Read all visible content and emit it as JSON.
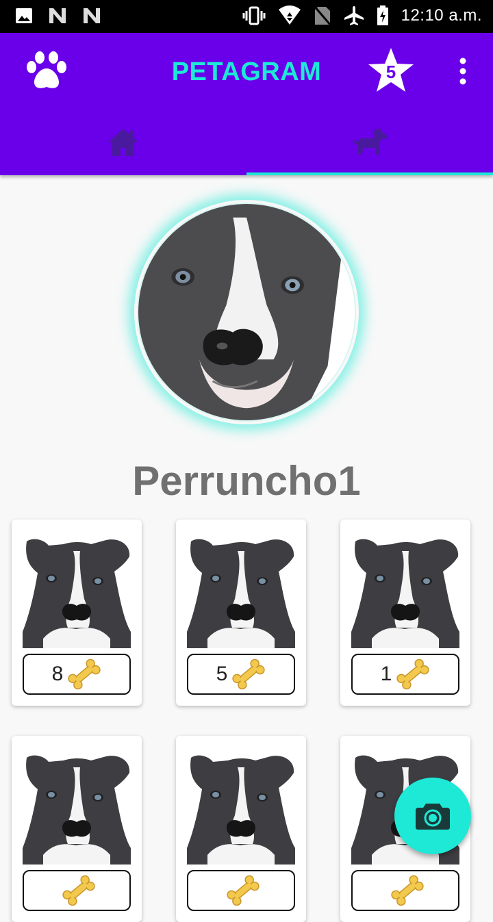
{
  "status_bar": {
    "time": "12:10 a.m.",
    "left_icons": [
      "image-icon",
      "n-icon",
      "n-icon"
    ],
    "right_icons": [
      "vibrate-icon",
      "wifi-icon",
      "no-sim-icon",
      "airplane-icon",
      "battery-charging-icon"
    ]
  },
  "app_bar": {
    "title": "PETAGRAM",
    "favorites_count": "5",
    "left_icon": "paw-icon",
    "menu_icon": "more-vert-icon"
  },
  "tabs": [
    {
      "icon": "home-icon",
      "selected": false
    },
    {
      "icon": "dog-icon",
      "selected": true
    }
  ],
  "profile": {
    "username": "Perruncho1"
  },
  "photos": [
    {
      "likes": "8"
    },
    {
      "likes": "5"
    },
    {
      "likes": "1"
    },
    {
      "likes": ""
    },
    {
      "likes": ""
    },
    {
      "likes": ""
    }
  ],
  "fab": {
    "icon": "camera-icon"
  },
  "colors": {
    "primary": "#6a00ea",
    "accent": "#1de9d6",
    "background": "#f8f8f8"
  }
}
